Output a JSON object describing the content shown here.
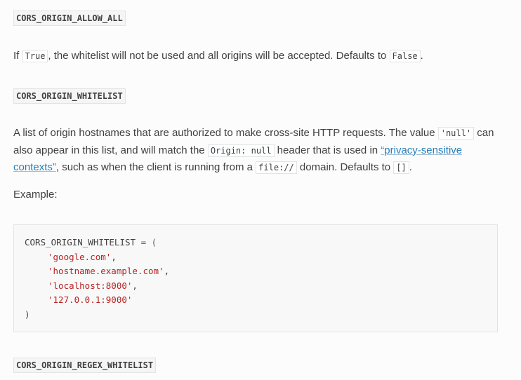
{
  "settings": {
    "allow_all": {
      "name": "CORS_ORIGIN_ALLOW_ALL",
      "desc_prefix": "If ",
      "desc_code1": "True",
      "desc_mid": ", the whitelist will not be used and all origins will be accepted. Defaults to ",
      "desc_code2": "False",
      "desc_suffix": "."
    },
    "whitelist": {
      "name": "CORS_ORIGIN_WHITELIST",
      "desc_part1": "A list of origin hostnames that are authorized to make cross-site HTTP requests. The value ",
      "desc_code1": "'null'",
      "desc_part2": " can also appear in this list, and will match the ",
      "desc_code2": "Origin: null",
      "desc_part3": " header that is used in ",
      "desc_link": "“privacy-sensitive contexts”",
      "desc_part4": ", such as when the client is running from a ",
      "desc_code3": "file://",
      "desc_part5": " domain. Defaults to ",
      "desc_code4": "[]",
      "desc_part6": ".",
      "example_label": "Example:",
      "code": {
        "head_name": "CORS_ORIGIN_WHITELIST",
        "head_op": " = (",
        "items": [
          "'google.com'",
          "'hostname.example.com'",
          "'localhost:8000'",
          "'127.0.0.1:9000'"
        ],
        "comma": ",",
        "close": ")"
      }
    },
    "regex_whitelist": {
      "name": "CORS_ORIGIN_REGEX_WHITELIST"
    }
  }
}
